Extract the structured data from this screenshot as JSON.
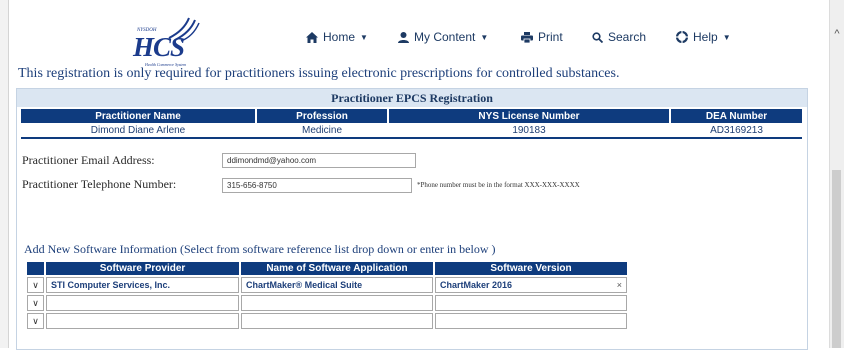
{
  "logo": {
    "small": "NYSDOH",
    "main": "HCS",
    "sub": "Health Commerce System"
  },
  "nav": {
    "home": "Home",
    "my_content": "My Content",
    "print": "Print",
    "search": "Search",
    "help": "Help"
  },
  "notice": "This registration is only required for practitioners issuing electronic prescriptions for controlled substances.",
  "panel": {
    "title": "Practitioner EPCS Registration"
  },
  "practitioner_table": {
    "headers": [
      "Practitioner Name",
      "Profession",
      "NYS License Number",
      "DEA Number"
    ],
    "row": [
      "Dimond Diane Arlene",
      "Medicine",
      "190183",
      "AD3169213"
    ]
  },
  "form": {
    "email_label": "Practitioner Email Address:",
    "email_value": "ddimondmd@yahoo.com",
    "phone_label": "Practitioner Telephone Number:",
    "phone_value": "315-656-8750",
    "phone_hint": "*Phone number must be in the format XXX-XXX-XXXX"
  },
  "software": {
    "heading": "Add New Software Information (Select from software reference list drop down or enter in below )",
    "headers": [
      "Software Provider",
      "Name of Software Application",
      "Software Version"
    ],
    "rows": [
      [
        "STI Computer Services, Inc.",
        "ChartMaker® Medical Suite",
        "ChartMaker 2016"
      ],
      [
        "",
        "",
        ""
      ],
      [
        "",
        "",
        ""
      ]
    ],
    "clear_symbol": "×",
    "dropdown_symbol": "∨"
  }
}
